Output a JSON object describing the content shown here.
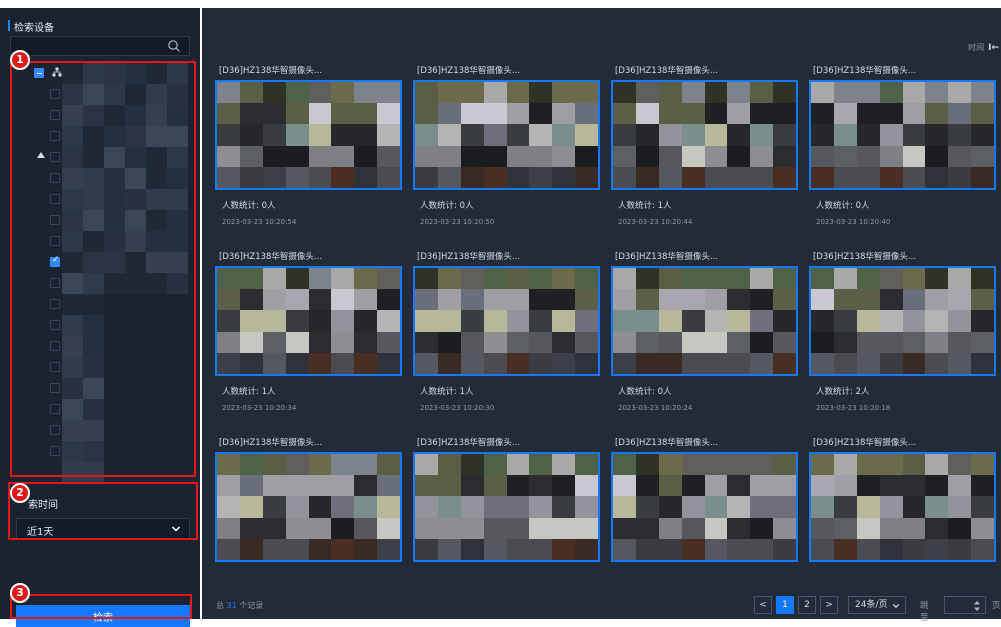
{
  "sidebar": {
    "title": "检索设备",
    "search": {
      "placeholder": ""
    },
    "tree": {
      "rows": [
        {
          "kind": "root",
          "checkbox": "partial"
        },
        {
          "kind": "item",
          "checkbox": "unchecked"
        },
        {
          "kind": "item",
          "checkbox": "unchecked"
        },
        {
          "kind": "item",
          "checkbox": "unchecked"
        },
        {
          "kind": "group",
          "checkbox": "unchecked"
        },
        {
          "kind": "item",
          "checkbox": "unchecked"
        },
        {
          "kind": "item",
          "checkbox": "unchecked"
        },
        {
          "kind": "item",
          "checkbox": "unchecked"
        },
        {
          "kind": "item",
          "checkbox": "unchecked"
        },
        {
          "kind": "item",
          "checkbox": "checked"
        },
        {
          "kind": "item",
          "checkbox": "unchecked"
        },
        {
          "kind": "item",
          "checkbox": "unchecked"
        },
        {
          "kind": "item",
          "checkbox": "unchecked"
        },
        {
          "kind": "item",
          "checkbox": "unchecked"
        },
        {
          "kind": "item",
          "checkbox": "unchecked"
        },
        {
          "kind": "item",
          "checkbox": "unchecked"
        },
        {
          "kind": "item",
          "checkbox": "unchecked"
        },
        {
          "kind": "item",
          "checkbox": "unchecked"
        },
        {
          "kind": "item",
          "checkbox": "unchecked"
        }
      ]
    },
    "time_label": "索时间",
    "time_select": {
      "value": "近1天"
    },
    "search_button": "检索"
  },
  "annotations": {
    "badge1": "1",
    "badge2": "2",
    "badge3": "3"
  },
  "main": {
    "time_header": {
      "label": "时间",
      "value": "I←"
    },
    "cards": [
      {
        "title": "[D36]HZ138华智摄像头...",
        "count": "人数统计:  0人",
        "timestamp": "2023-03-23 10:20:54"
      },
      {
        "title": "[D36]HZ138华智摄像头...",
        "count": "人数统计:  0人",
        "timestamp": "2023-03-23 10:20:50"
      },
      {
        "title": "[D36]HZ138华智摄像头...",
        "count": "人数统计:  1人",
        "timestamp": "2023-03-23 10:20:44"
      },
      {
        "title": "[D36]HZ138华智摄像头...",
        "count": "人数统计:  0人",
        "timestamp": "2023-03-23 10:20:40"
      },
      {
        "title": "[D36]HZ138华智摄像头...",
        "count": "人数统计:  1人",
        "timestamp": "2023-03-23 10:20:34"
      },
      {
        "title": "[D36]HZ138华智摄像头...",
        "count": "人数统计:  1人",
        "timestamp": "2023-03-23 10:20:30"
      },
      {
        "title": "[D36]HZ138华智摄像头...",
        "count": "人数统计:  0人",
        "timestamp": "2023-03-23 10:20:24"
      },
      {
        "title": "[D36]HZ138华智摄像头...",
        "count": "人数统计:  2人",
        "timestamp": "2023-03-23 10:20:18"
      },
      {
        "title": "[D36]HZ138华智摄像头...",
        "count": "",
        "timestamp": ""
      },
      {
        "title": "[D36]HZ138华智摄像头...",
        "count": "",
        "timestamp": ""
      },
      {
        "title": "[D36]HZ138华智摄像头...",
        "count": "",
        "timestamp": ""
      },
      {
        "title": "[D36]HZ138华智摄像头...",
        "count": "",
        "timestamp": ""
      }
    ],
    "footer": {
      "total_prefix": "总",
      "total_count": "31",
      "total_suffix": "个记录",
      "pages": [
        "1",
        "2"
      ],
      "current_page": "1",
      "prev": "<",
      "next": ">",
      "page_size": "24条/页",
      "jump_label": "跳至",
      "page_unit": "页"
    }
  },
  "colors": {
    "sidebar_bg": "#1b2330",
    "main_bg": "#232b38",
    "accent": "#1677ff",
    "annotation_red": "#e01818"
  }
}
